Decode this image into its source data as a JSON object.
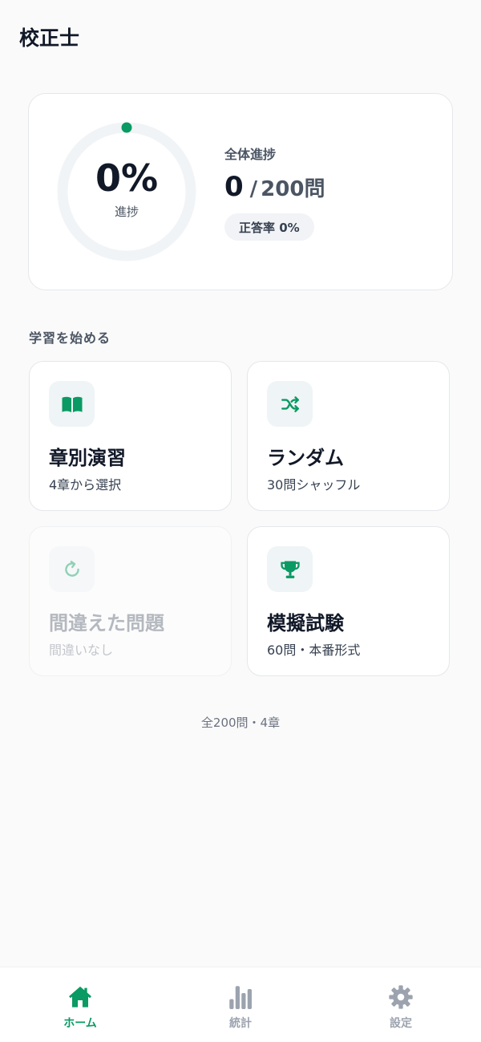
{
  "app": {
    "title": "校正士"
  },
  "progress": {
    "percent_text": "0%",
    "percent_value": 0,
    "ring_label": "進捗",
    "overall_label": "全体進捗",
    "completed": "0",
    "separator": "/",
    "total": "200問",
    "accuracy": "正答率 0%"
  },
  "section": {
    "title": "学習を始める"
  },
  "modes": [
    {
      "icon": "book-icon",
      "title": "章別演習",
      "subtitle": "4章から選択",
      "enabled": true
    },
    {
      "icon": "shuffle-icon",
      "title": "ランダム",
      "subtitle": "30問シャッフル",
      "enabled": true
    },
    {
      "icon": "retry-icon",
      "title": "間違えた問題",
      "subtitle": "間違いなし",
      "enabled": false
    },
    {
      "icon": "trophy-icon",
      "title": "模擬試験",
      "subtitle": "60問・本番形式",
      "enabled": true
    }
  ],
  "footer": {
    "note": "全200問・4章"
  },
  "nav": {
    "items": [
      {
        "icon": "home-icon",
        "label": "ホーム",
        "active": true
      },
      {
        "icon": "bar-chart-icon",
        "label": "統計",
        "active": false
      },
      {
        "icon": "gear-icon",
        "label": "設定",
        "active": false
      }
    ]
  },
  "colors": {
    "accent": "#0a9a63",
    "background": "#fafafa",
    "card": "#ffffff",
    "ring_track": "#f1f4f6",
    "text_primary": "#111827",
    "text_secondary": "#4b5563",
    "inactive_nav": "#9ca3af"
  }
}
